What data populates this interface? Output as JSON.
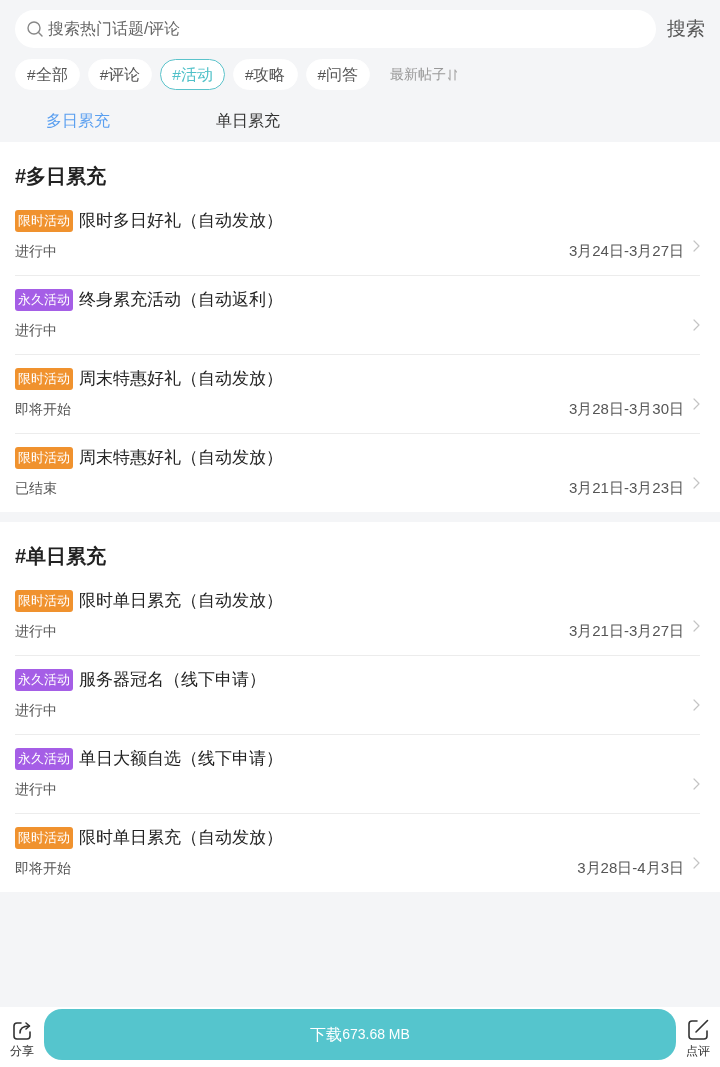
{
  "search": {
    "placeholder": "搜索热门话题/评论",
    "button": "搜索"
  },
  "filters": [
    {
      "label": "#全部",
      "selected": false
    },
    {
      "label": "#评论",
      "selected": false
    },
    {
      "label": "#活动",
      "selected": true
    },
    {
      "label": "#攻略",
      "selected": false
    },
    {
      "label": "#问答",
      "selected": false
    }
  ],
  "sort": {
    "label": "最新帖子"
  },
  "tabs": [
    {
      "label": "多日累充",
      "selected": true
    },
    {
      "label": "单日累充",
      "selected": false
    }
  ],
  "sections": [
    {
      "title": "#多日累充",
      "items": [
        {
          "tag": {
            "label": "限时活动",
            "color": "#f0922e"
          },
          "title": "限时多日好礼（自动发放）",
          "status": "进行中",
          "date": "3月24日-3月27日"
        },
        {
          "tag": {
            "label": "永久活动",
            "color": "#a55ee6"
          },
          "title": "终身累充活动（自动返利）",
          "status": "进行中"
        },
        {
          "tag": {
            "label": "限时活动",
            "color": "#f0922e"
          },
          "title": "周末特惠好礼（自动发放）",
          "status": "即将开始",
          "date": "3月28日-3月30日"
        },
        {
          "tag": {
            "label": "限时活动",
            "color": "#f0922e"
          },
          "title": "周末特惠好礼（自动发放）",
          "status": "已结束",
          "date": "3月21日-3月23日"
        }
      ]
    },
    {
      "title": "#单日累充",
      "items": [
        {
          "tag": {
            "label": "限时活动",
            "color": "#f0922e"
          },
          "title": "限时单日累充（自动发放）",
          "status": "进行中",
          "date": "3月21日-3月27日"
        },
        {
          "tag": {
            "label": "永久活动",
            "color": "#a55ee6"
          },
          "title": "服务器冠名（线下申请）",
          "status": "进行中"
        },
        {
          "tag": {
            "label": "永久活动",
            "color": "#a55ee6"
          },
          "title": "单日大额自选（线下申请）",
          "status": "进行中"
        },
        {
          "tag": {
            "label": "限时活动",
            "color": "#f0922e"
          },
          "title": "限时单日累充（自动发放）",
          "status": "即将开始",
          "date": "3月28日-4月3日"
        }
      ]
    }
  ],
  "bottom_bar": {
    "share": "分享",
    "download": {
      "label": "下载",
      "size": "673.68 MB"
    },
    "review": "点评"
  }
}
